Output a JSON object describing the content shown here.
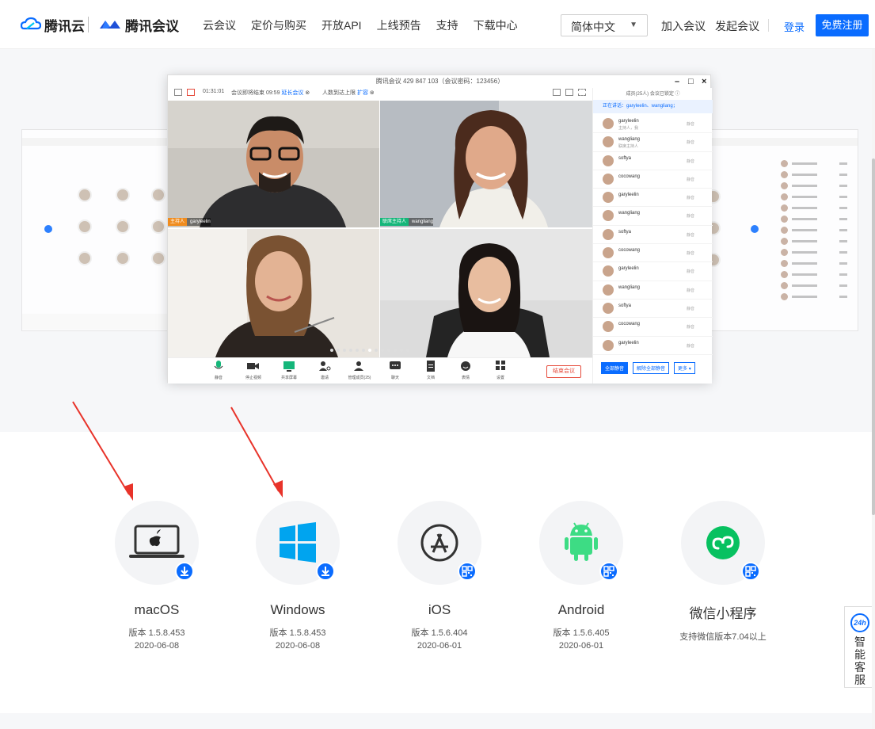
{
  "header": {
    "brand1": "腾讯云",
    "brand2": "腾讯会议",
    "nav": [
      "云会议",
      "定价与购买",
      "开放API",
      "上线预告",
      "支持",
      "下载中心"
    ],
    "language": "简体中文",
    "join_meeting": "加入会议",
    "start_meeting": "发起会议",
    "login": "登录",
    "register": "免费注册"
  },
  "meeting": {
    "title": "腾讯会议 429 847 103（会议密码：123456）",
    "timer": "01:31:01",
    "ends_text": "会议即将结束 09:59",
    "extend_label": "延长会议",
    "capacity_text": "人数到达上限",
    "expand_label": "扩容",
    "members_header": "成员(25人)  会议已锁定 ⓘ",
    "speaking": "正在讲话：garyleelin、wangliang；",
    "tiles": [
      {
        "tag": "主持人",
        "name": "garyleelin"
      },
      {
        "tag": "联席主持人",
        "name": "wangliang"
      },
      {
        "tag": "",
        "name": ""
      },
      {
        "tag": "",
        "name": ""
      }
    ],
    "controls": [
      "静音",
      "停止视频",
      "共享屏幕",
      "邀请",
      "管理成员(25)",
      "聊天",
      "文档",
      "表情",
      "设置"
    ],
    "end_button": "结束会议",
    "members": [
      {
        "name": "garyleelin",
        "sub": "主持人，我"
      },
      {
        "name": "wangliang",
        "sub": "联席主持人"
      },
      {
        "name": "softya",
        "sub": ""
      },
      {
        "name": "cocowang",
        "sub": ""
      },
      {
        "name": "garyleelin",
        "sub": ""
      },
      {
        "name": "wangliang",
        "sub": ""
      },
      {
        "name": "softya",
        "sub": ""
      },
      {
        "name": "cocowang",
        "sub": ""
      },
      {
        "name": "garyleelin",
        "sub": ""
      },
      {
        "name": "wangliang",
        "sub": ""
      },
      {
        "name": "softya",
        "sub": ""
      },
      {
        "name": "cocowang",
        "sub": ""
      },
      {
        "name": "garyleelin",
        "sub": ""
      }
    ],
    "member_status": "静音",
    "member_buttons": [
      "全部静音",
      "解除全部静音",
      "更多 ▾"
    ]
  },
  "platforms": [
    {
      "name": "macOS",
      "version": "版本 1.5.8.453",
      "date": "2020-06-08",
      "icon": "laptop-apple-icon",
      "badge": "download-icon"
    },
    {
      "name": "Windows",
      "version": "版本 1.5.8.453",
      "date": "2020-06-08",
      "icon": "windows-icon",
      "badge": "download-icon"
    },
    {
      "name": "iOS",
      "version": "版本 1.5.6.404",
      "date": "2020-06-01",
      "icon": "app-store-icon",
      "badge": "qrcode-icon"
    },
    {
      "name": "Android",
      "version": "版本 1.5.6.405",
      "date": "2020-06-01",
      "icon": "android-icon",
      "badge": "qrcode-icon"
    },
    {
      "name": "微信小程序",
      "version": "支持微信版本7.04以上",
      "date": "",
      "icon": "wechat-miniprogram-icon",
      "badge": "qrcode-icon"
    }
  ],
  "service": {
    "badge": "24h",
    "label": "智能客服"
  },
  "colors": {
    "accent": "#0a6cff",
    "danger": "#e64b3c",
    "android": "#3ddc84",
    "wechat": "#07c160",
    "windows": "#00a4ef"
  }
}
